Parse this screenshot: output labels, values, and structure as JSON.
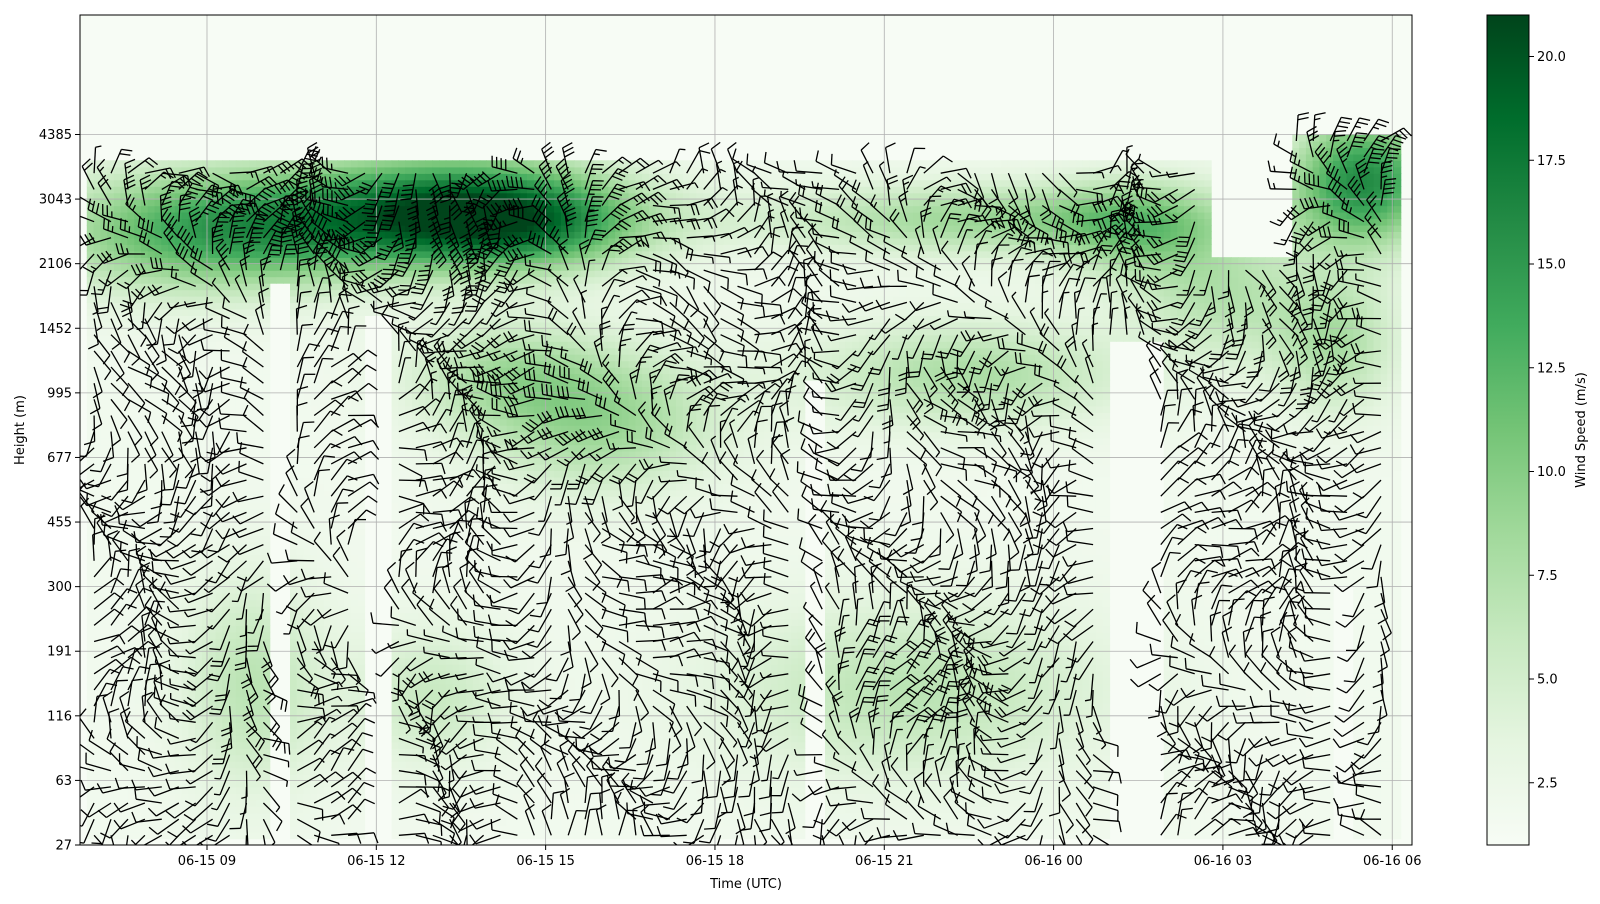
{
  "chart_data": {
    "type": "heatmap",
    "xlabel": "Time (UTC)",
    "ylabel": "Height (m)",
    "x_ticks": [
      {
        "label": "06-15 09",
        "hours": 9
      },
      {
        "label": "06-15 12",
        "hours": 12
      },
      {
        "label": "06-15 15",
        "hours": 15
      },
      {
        "label": "06-15 18",
        "hours": 18
      },
      {
        "label": "06-15 21",
        "hours": 21
      },
      {
        "label": "06-16 00",
        "hours": 24
      },
      {
        "label": "06-16 03",
        "hours": 27
      },
      {
        "label": "06-16 06",
        "hours": 30
      }
    ],
    "y_ticks": [
      "27",
      "63",
      "116",
      "191",
      "300",
      "455",
      "677",
      "995",
      "1452",
      "2106",
      "3043",
      "4385"
    ],
    "grid": true,
    "colorbar": {
      "label": "Wind Speed (m/s)",
      "range": [
        1,
        21
      ],
      "ticks": [
        "2.5",
        "5.0",
        "7.5",
        "10.0",
        "12.5",
        "15.0",
        "17.5",
        "20.0"
      ],
      "colors": [
        "#f7fcf5",
        "#e5f5e0",
        "#c7e9c0",
        "#a1d99b",
        "#74c476",
        "#41ab5d",
        "#238b45",
        "#006d2c",
        "#00441b"
      ]
    },
    "time_range_hours": [
      6.75,
      30.35
    ],
    "height_index_range": [
      0,
      12
    ],
    "columns": {
      "start": 7.0,
      "end": 30.1,
      "step": 0.3
    },
    "data_gaps": [
      {
        "from": 10.1,
        "to": 10.5,
        "max_level": 8.7
      },
      {
        "from": 11.8,
        "to": 12.3,
        "max_level": 8.2
      },
      {
        "from": 19.6,
        "to": 19.9,
        "max_level": 7.2
      },
      {
        "from": 25.0,
        "to": 25.9,
        "max_level": 7.8
      },
      {
        "from": 29.0,
        "to": 29.3,
        "max_level": 4.0
      }
    ],
    "column_coverage": [
      {
        "from": 6.9,
        "to": 26.8,
        "min_level": 0.1,
        "max_level": 10.6
      },
      {
        "from": 26.8,
        "to": 28.2,
        "min_level": 0.1,
        "max_level": 9.1
      },
      {
        "from": 28.2,
        "to": 30.2,
        "min_level": 0.1,
        "max_level": 11.0
      }
    ],
    "speed_features": [
      {
        "hours": 8.5,
        "level": 9.5,
        "speed": 8,
        "spread_hours": 1.8,
        "spread_levels": 0.7
      },
      {
        "hours": 11.0,
        "level": 9.6,
        "speed": 9,
        "spread_hours": 2.0,
        "spread_levels": 0.6
      },
      {
        "hours": 13.5,
        "level": 9.9,
        "speed": 12,
        "spread_hours": 1.8,
        "spread_levels": 0.6
      },
      {
        "hours": 14.8,
        "level": 9.6,
        "speed": 9,
        "spread_hours": 1.5,
        "spread_levels": 0.5
      },
      {
        "hours": 16.0,
        "level": 6.6,
        "speed": 7,
        "spread_hours": 1.5,
        "spread_levels": 0.8
      },
      {
        "hours": 14.2,
        "level": 7.3,
        "speed": 5,
        "spread_hours": 1.2,
        "spread_levels": 0.6
      },
      {
        "hours": 22.5,
        "level": 7.3,
        "speed": 6,
        "spread_hours": 2.0,
        "spread_levels": 0.6
      },
      {
        "hours": 23.0,
        "level": 9.7,
        "speed": 7,
        "spread_hours": 3.0,
        "spread_levels": 0.4
      },
      {
        "hours": 21.5,
        "level": 2.4,
        "speed": 5,
        "spread_hours": 2.5,
        "spread_levels": 1.0
      },
      {
        "hours": 9.8,
        "level": 2.5,
        "speed": 5,
        "spread_hours": 0.9,
        "spread_levels": 1.2
      },
      {
        "hours": 13.0,
        "level": 2.3,
        "speed": 4,
        "spread_hours": 1.0,
        "spread_levels": 0.8
      },
      {
        "hours": 27.0,
        "level": 8.5,
        "speed": 5,
        "spread_hours": 1.0,
        "spread_levels": 0.7
      },
      {
        "hours": 29.5,
        "level": 10.3,
        "speed": 14,
        "spread_hours": 0.9,
        "spread_levels": 0.7
      },
      {
        "hours": 29.0,
        "level": 7.8,
        "speed": 6,
        "spread_hours": 0.8,
        "spread_levels": 0.8
      },
      {
        "hours": 25.5,
        "level": 9.5,
        "speed": 6,
        "spread_hours": 1.0,
        "spread_levels": 0.6
      }
    ]
  }
}
